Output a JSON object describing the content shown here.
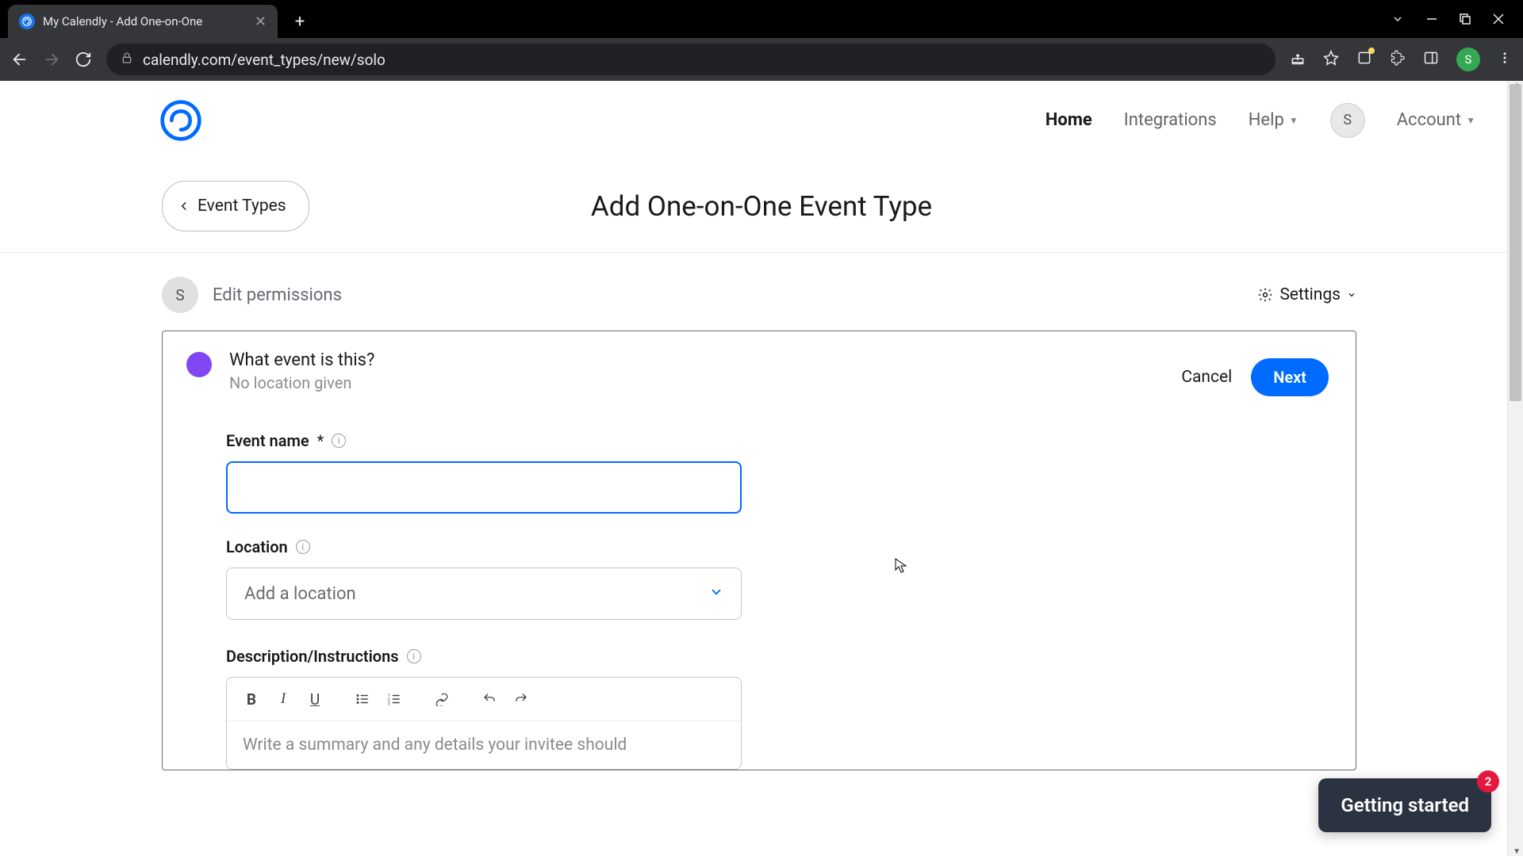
{
  "browser": {
    "tab_title": "My Calendly - Add One-on-One",
    "url": "calendly.com/event_types/new/solo",
    "profile_initial": "S"
  },
  "header": {
    "nav_home": "Home",
    "nav_integrations": "Integrations",
    "nav_help": "Help",
    "nav_account": "Account",
    "avatar_initial": "S"
  },
  "subheader": {
    "back_label": "Event Types",
    "page_title": "Add One-on-One Event Type"
  },
  "permissions": {
    "avatar_initial": "S",
    "edit_label": "Edit permissions",
    "settings_label": "Settings"
  },
  "card": {
    "question": "What event is this?",
    "subtitle": "No location given",
    "cancel_label": "Cancel",
    "next_label": "Next",
    "color": "#8247f5"
  },
  "fields": {
    "event_name_label": "Event name",
    "required_mark": "*",
    "event_name_value": "",
    "location_label": "Location",
    "location_placeholder": "Add a location",
    "description_label": "Description/Instructions",
    "description_placeholder": "Write a summary and any details your invitee should"
  },
  "help": {
    "label": "Getting started",
    "badge": "2"
  }
}
